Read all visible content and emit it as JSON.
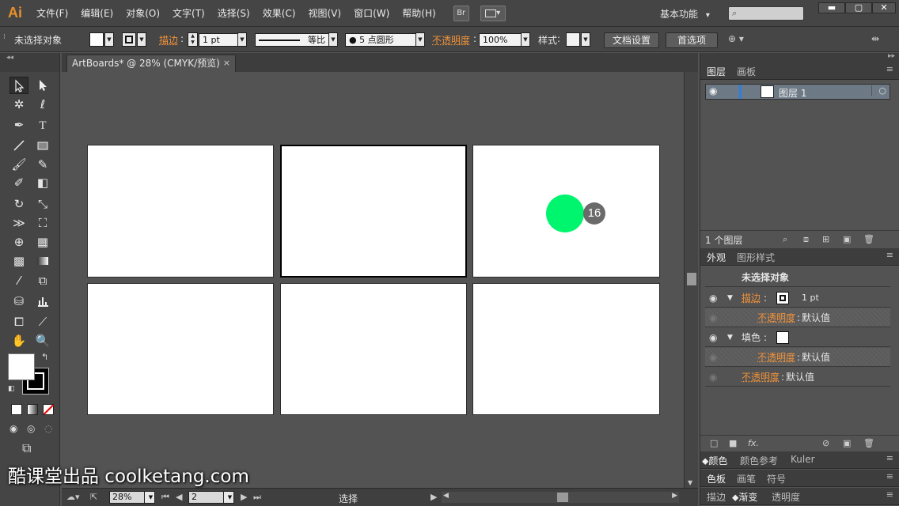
{
  "app": {
    "logo": "Ai"
  },
  "menu": [
    "文件(F)",
    "编辑(E)",
    "对象(O)",
    "文字(T)",
    "选择(S)",
    "效果(C)",
    "视图(V)",
    "窗口(W)",
    "帮助(H)"
  ],
  "menubar": {
    "bridge_label": "Br",
    "workspace": "基本功能",
    "workspace_arrow": "▾",
    "min": "▬",
    "max": "▢",
    "close": "✕"
  },
  "controlbar": {
    "selection_status": "未选择对象",
    "stroke_label": "描边",
    "stroke_weight": "1 pt",
    "stroke_profile": "等比",
    "brush": "● 5 点圆形",
    "opacity_label": "不透明度",
    "opacity_value": "100%",
    "style_label": "样式",
    "doc_setup": "文档设置",
    "preferences": "首选项"
  },
  "document_tab": {
    "title": "ArtBoards* @ 28% (CMYK/预览)",
    "close": "×"
  },
  "artboards": [
    {
      "id": 1,
      "active": false
    },
    {
      "id": 2,
      "active": true
    },
    {
      "id": 3,
      "active": false
    },
    {
      "id": 4,
      "active": false
    },
    {
      "id": 5,
      "active": false
    },
    {
      "id": 6,
      "active": false
    }
  ],
  "cursor_overlay": {
    "click_count": "16",
    "color": "#00f56e"
  },
  "statusbar": {
    "zoom": "28%",
    "artboard_nav": "2",
    "mode": "选择"
  },
  "watermark": "酷课堂出品 coolketang.com",
  "layers_panel": {
    "tabs": [
      "图层",
      "画板"
    ],
    "layer_name": "图层 1",
    "count_label": "1 个图层"
  },
  "appearance_panel": {
    "tabs": [
      "外观",
      "图形样式"
    ],
    "header": "未选择对象",
    "stroke_label": "描边",
    "stroke_value": "1 pt",
    "opacity_label": "不透明度",
    "default_value": "默认值",
    "fill_label": "填色",
    "fx_label": "fx."
  },
  "color_panel": {
    "tabs": [
      "颜色",
      "颜色参考",
      "Kuler"
    ]
  },
  "swatch_panel": {
    "tabs": [
      "色板",
      "画笔",
      "符号"
    ]
  },
  "stroke_panel": {
    "tabs": [
      "描边",
      "渐变",
      "透明度"
    ]
  },
  "colors": {
    "accent_orange": "#f0923a",
    "layer_highlight": "#2a7fe0"
  }
}
